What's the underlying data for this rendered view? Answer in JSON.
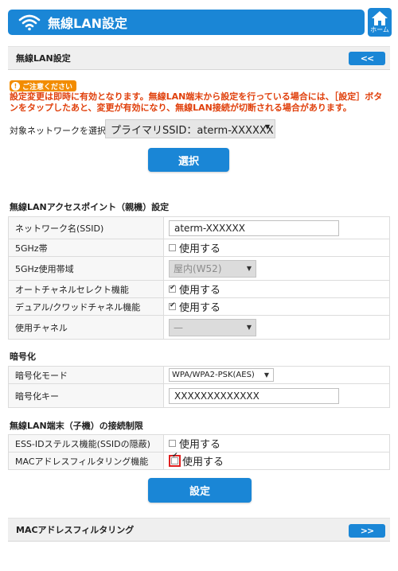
{
  "header": {
    "title": "無線LAN設定",
    "home_label": "ホーム"
  },
  "section_top": {
    "label": "無線LAN設定",
    "nav_label": "<<"
  },
  "notice": {
    "badge": "ご注意ください",
    "text": "設定変更は即時に有効となります。無線LAN端末から設定を行っている場合には、［設定］ボタンをタップしたあと、変更が有効になり、無線LAN接続が切断される場合があります。"
  },
  "target": {
    "label": "対象ネットワークを選択",
    "selected": "プライマリSSID：aterm-XXXXXX",
    "select_button": "選択"
  },
  "ap_settings": {
    "title": "無線LANアクセスポイント（親機）設定",
    "rows": {
      "ssid_label": "ネットワーク名(SSID)",
      "ssid_value": "aterm-XXXXXX",
      "band5_label": "5GHz帯",
      "band5_option": "使用する",
      "band5_use_label": "5GHz使用帯域",
      "band5_use_value": "屋内(W52)",
      "auto_channel_label": "オートチャネルセレクト機能",
      "auto_channel_option": "使用する",
      "dual_label": "デュアル/クワッドチャネル機能",
      "dual_option": "使用する",
      "channel_label": "使用チャネル",
      "channel_value": "—"
    }
  },
  "encryption": {
    "title": "暗号化",
    "mode_label": "暗号化モード",
    "mode_value": "WPA/WPA2-PSK(AES)",
    "key_label": "暗号化キー",
    "key_value": "XXXXXXXXXXXXX"
  },
  "restriction": {
    "title": "無線LAN端末（子機）の接続制限",
    "stealth_label": "ESS-IDステルス機能(SSIDの隠蔽)",
    "stealth_option": "使用する",
    "mac_label": "MACアドレスフィルタリング機能",
    "mac_option": "使用する"
  },
  "apply_button": "設定",
  "section_bottom": {
    "label": "MACアドレスフィルタリング",
    "nav_label": ">>"
  },
  "colors": {
    "primary": "#1a86d6",
    "warning": "#e0400c",
    "badge": "#f28c00",
    "highlight": "#e02020"
  }
}
